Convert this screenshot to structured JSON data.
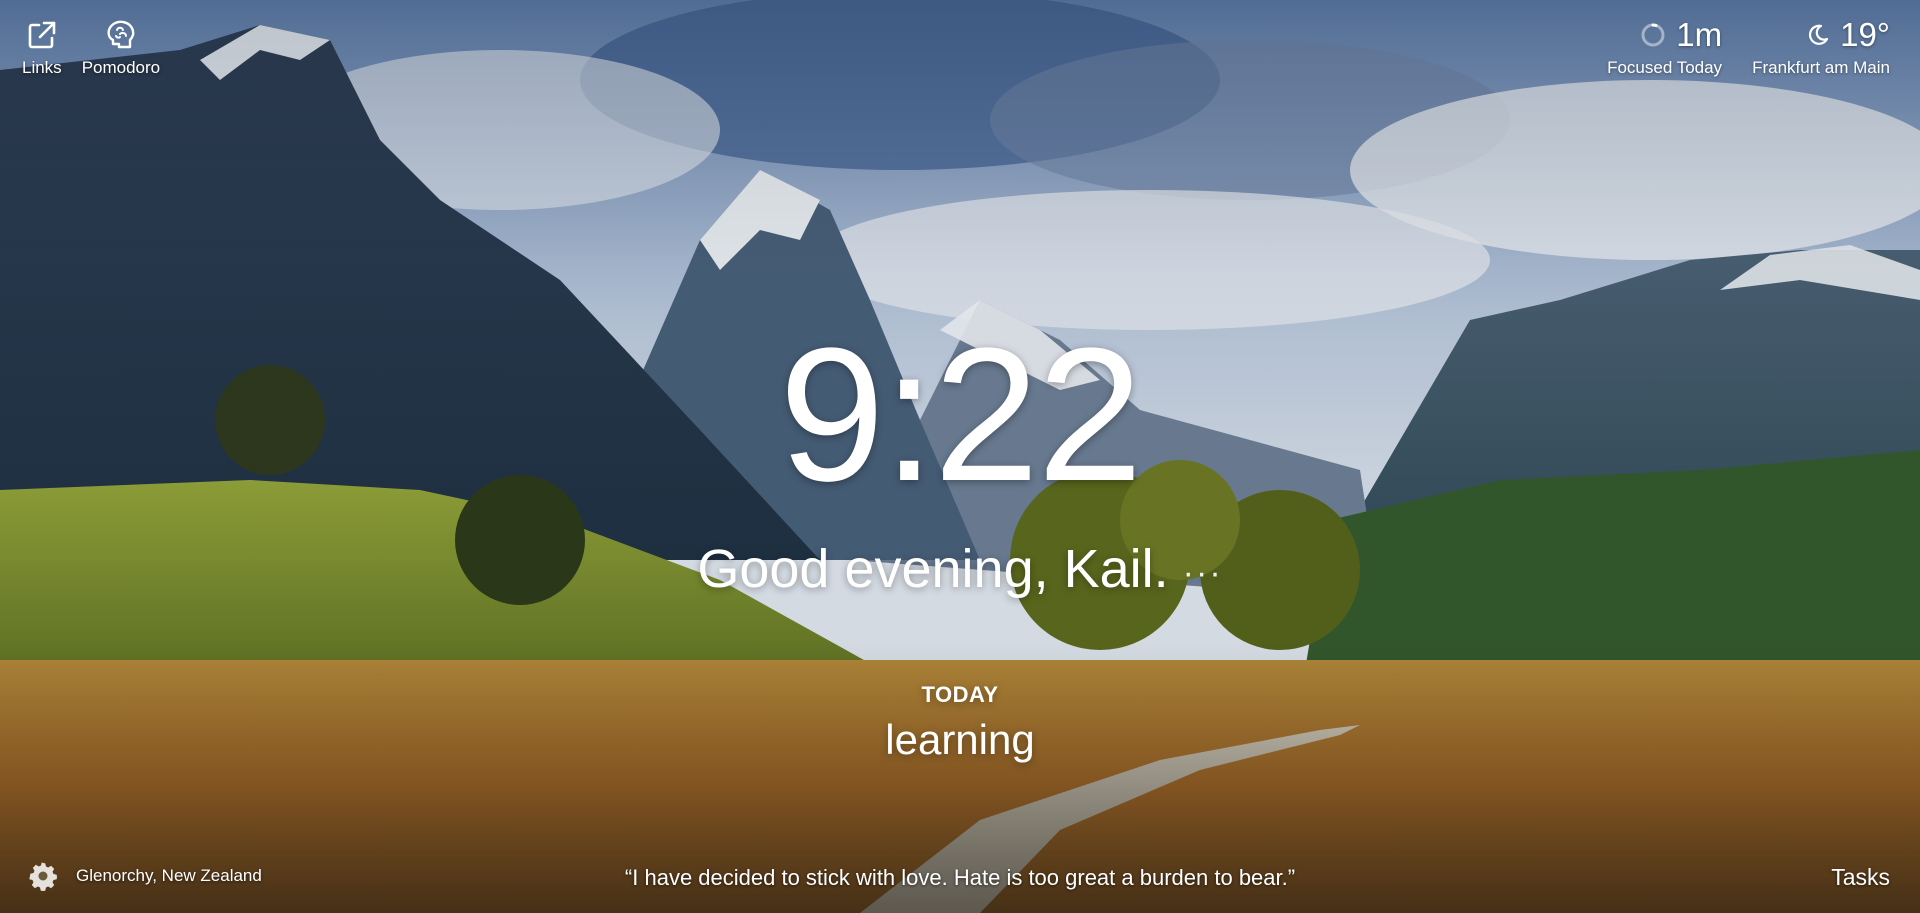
{
  "top_left": {
    "links_label": "Links",
    "pomodoro_label": "Pomodoro",
    "links_icon": "external-link-icon",
    "pomodoro_icon": "brain-icon"
  },
  "top_right": {
    "focus": {
      "value": "1m",
      "label": "Focused Today",
      "icon": "progress-ring-icon"
    },
    "weather": {
      "temp": "19°",
      "location": "Frankfurt am Main",
      "icon": "moon-icon"
    }
  },
  "main": {
    "time": "9:22",
    "greeting": "Good evening, Kail.",
    "greeting_menu": "···",
    "today_label": "TODAY",
    "today_focus": "learning"
  },
  "bottom": {
    "photo_location": "Glenorchy, New Zealand",
    "quote": "“I have decided to stick with love. Hate is too great a burden to bear.”",
    "tasks_label": "Tasks",
    "settings_icon": "gear-icon"
  }
}
